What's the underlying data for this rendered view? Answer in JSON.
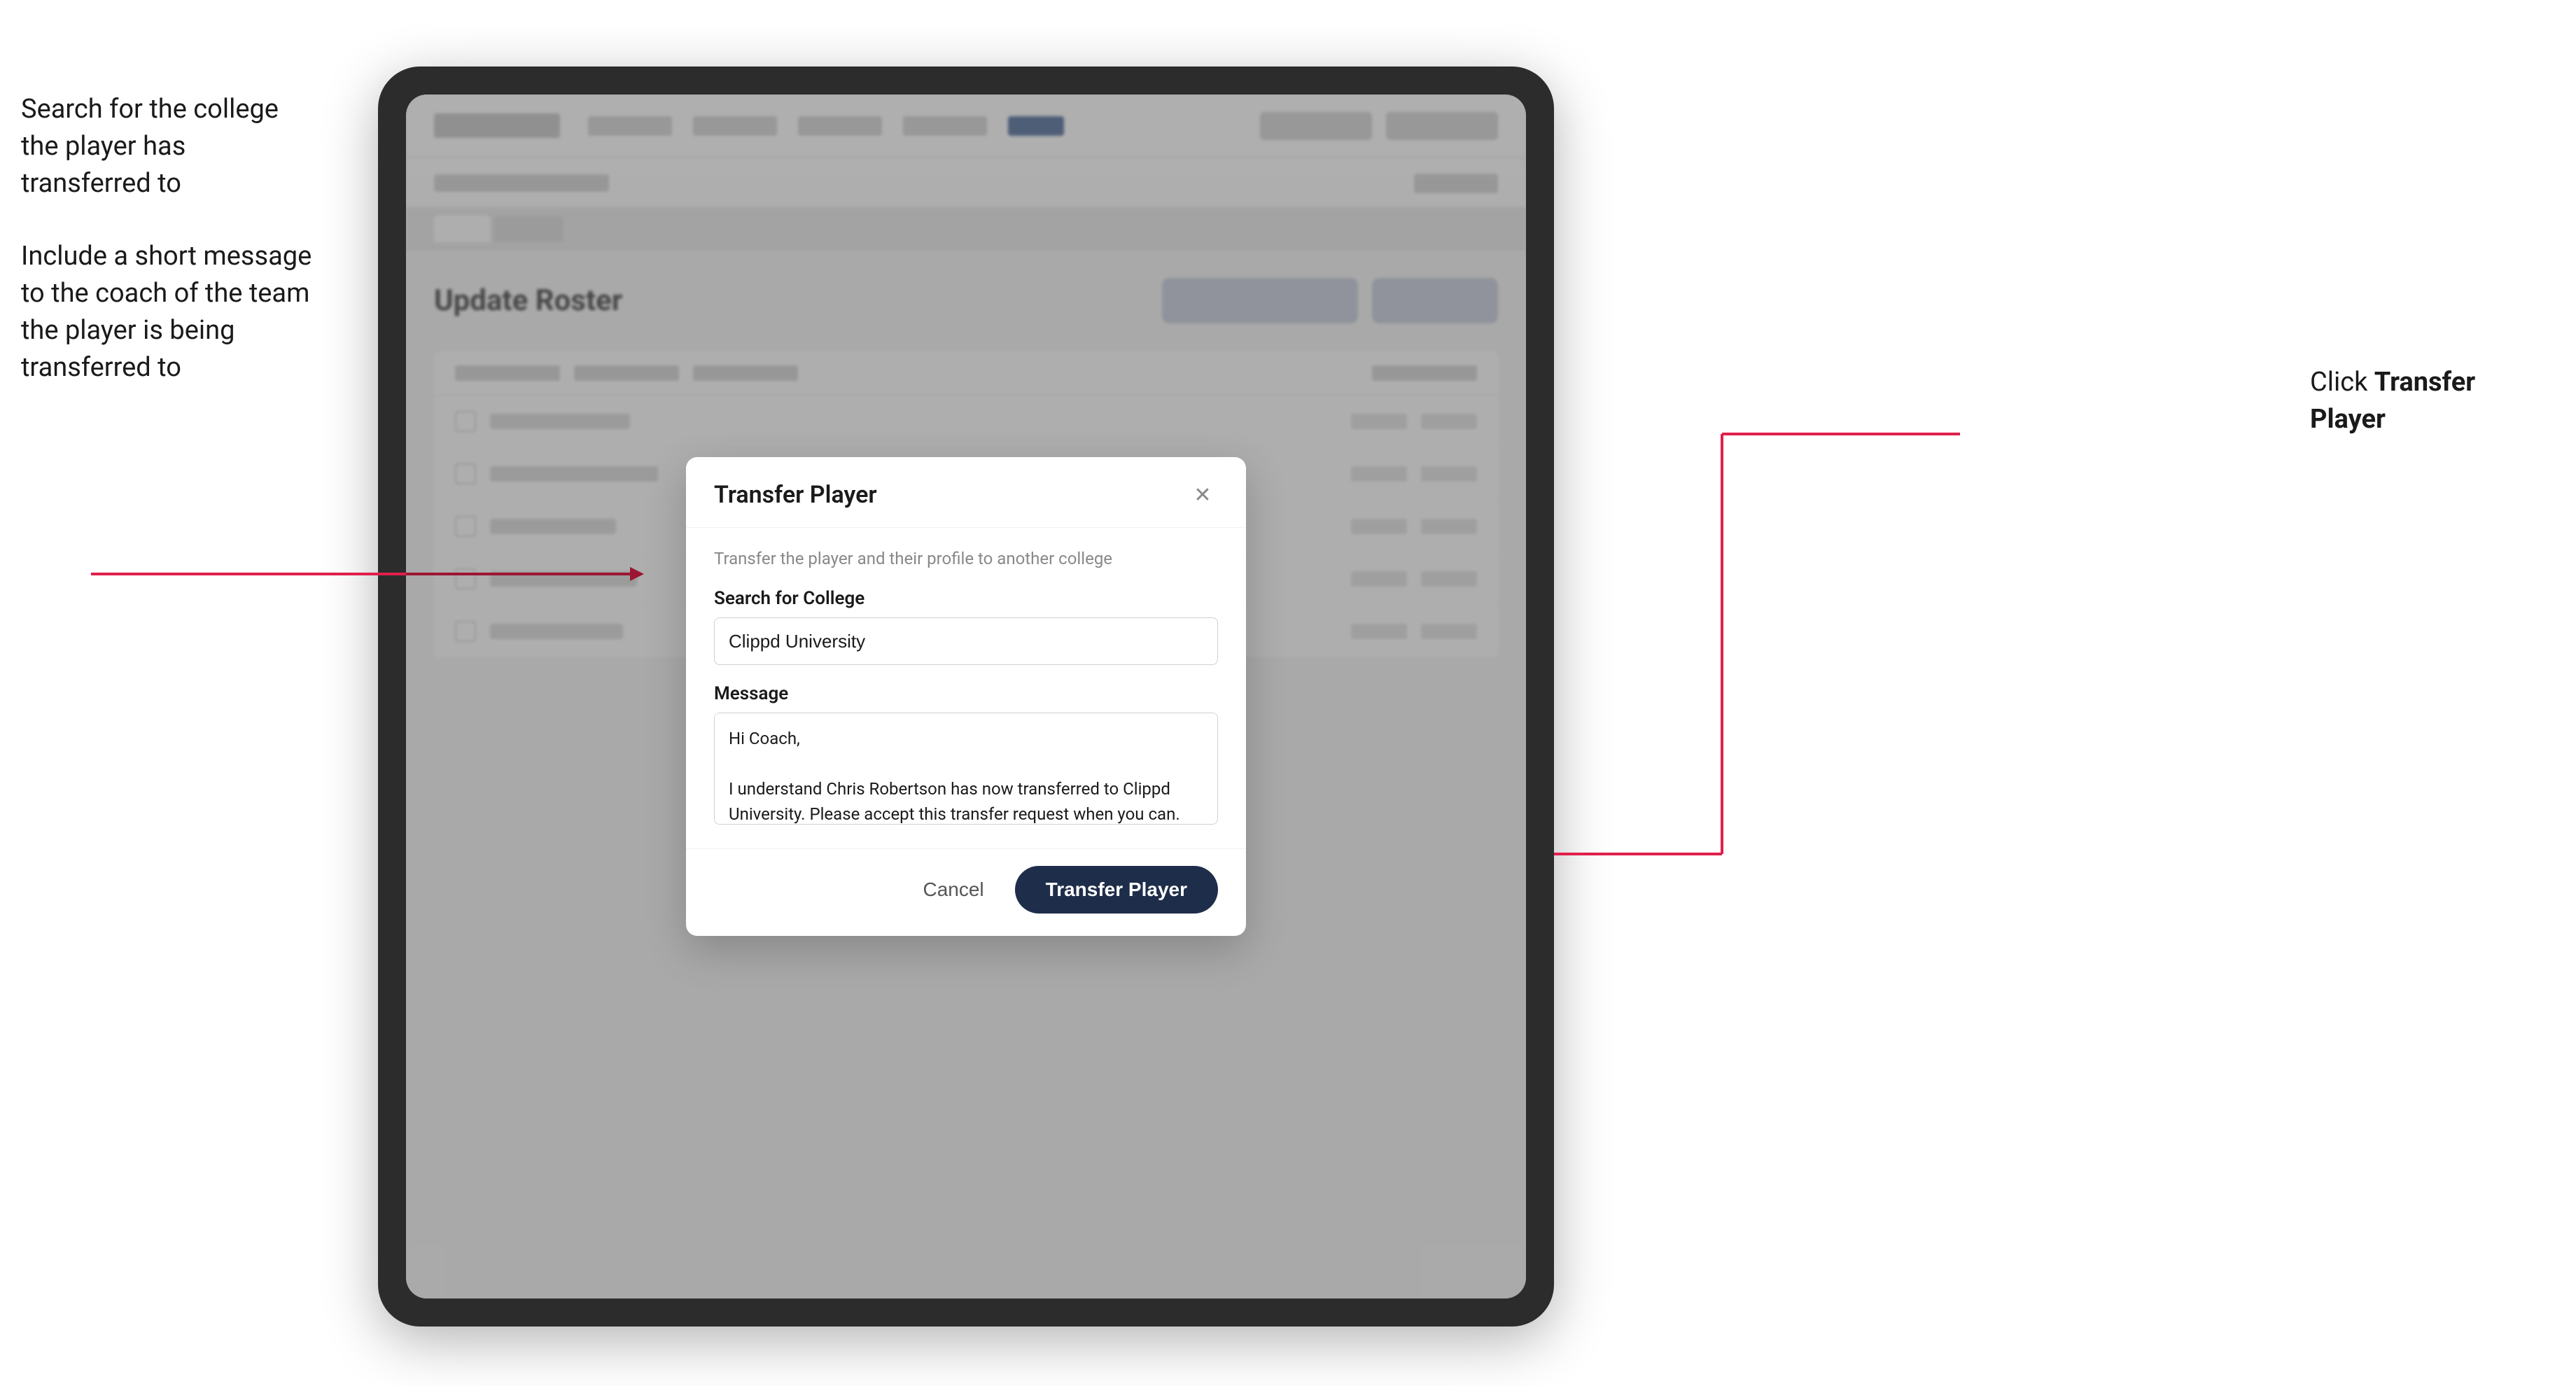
{
  "annotations": {
    "left_top": "Search for the college the player has transferred to",
    "left_bottom": "Include a short message to the coach of the team the player is being transferred to",
    "right": "Click Transfer Player"
  },
  "tablet": {
    "app": {
      "page_title": "Update Roster"
    }
  },
  "modal": {
    "title": "Transfer Player",
    "description": "Transfer the player and their profile to another college",
    "college_label": "Search for College",
    "college_value": "Clippd University",
    "message_label": "Message",
    "message_value": "Hi Coach,\n\nI understand Chris Robertson has now transferred to Clippd University. Please accept this transfer request when you can.",
    "cancel_label": "Cancel",
    "transfer_label": "Transfer Player"
  }
}
